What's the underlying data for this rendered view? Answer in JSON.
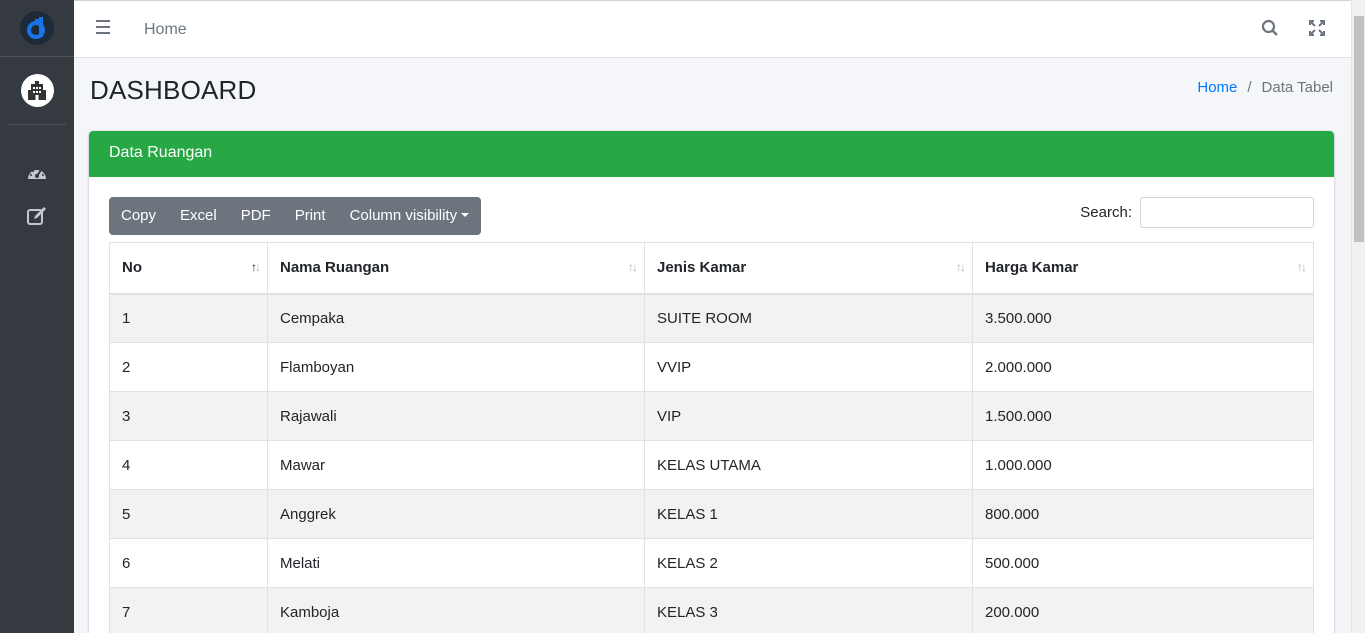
{
  "navbar": {
    "home_label": "Home"
  },
  "page": {
    "title": "DASHBOARD"
  },
  "breadcrumb": {
    "home": "Home",
    "separator": "/",
    "current": "Data Tabel"
  },
  "card": {
    "title": "Data Ruangan",
    "header_color": "#28a745"
  },
  "buttons": {
    "copy": "Copy",
    "excel": "Excel",
    "pdf": "PDF",
    "print": "Print",
    "column_visibility": "Column visibility"
  },
  "search": {
    "label": "Search:",
    "value": ""
  },
  "table": {
    "headers": [
      "No",
      "Nama Ruangan",
      "Jenis Kamar",
      "Harga Kamar"
    ],
    "sorted_column": "No",
    "sort_direction": "asc",
    "rows": [
      {
        "no": "1",
        "nama": "Cempaka",
        "jenis": "SUITE ROOM",
        "harga": "3.500.000"
      },
      {
        "no": "2",
        "nama": "Flamboyan",
        "jenis": "VVIP",
        "harga": "2.000.000"
      },
      {
        "no": "3",
        "nama": "Rajawali",
        "jenis": "VIP",
        "harga": "1.500.000"
      },
      {
        "no": "4",
        "nama": "Mawar",
        "jenis": "KELAS UTAMA",
        "harga": "1.000.000"
      },
      {
        "no": "5",
        "nama": "Anggrek",
        "jenis": "KELAS 1",
        "harga": "800.000"
      },
      {
        "no": "6",
        "nama": "Melati",
        "jenis": "KELAS 2",
        "harga": "500.000"
      },
      {
        "no": "7",
        "nama": "Kamboja",
        "jenis": "KELAS 3",
        "harga": "200.000"
      }
    ]
  },
  "icons": {
    "brand": "app-logo-icon",
    "avatar": "hospital-building-icon",
    "nav": [
      "dashboard-gauge-icon",
      "edit-form-icon"
    ],
    "toolbar": [
      "menu-icon",
      "search-icon",
      "fullscreen-icon"
    ]
  },
  "colors": {
    "sidebar": "#343a40",
    "accent": "#007bff",
    "button": "#6c757d"
  }
}
